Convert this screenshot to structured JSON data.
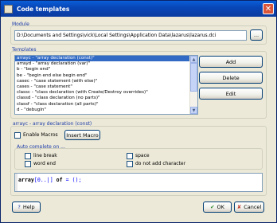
{
  "window": {
    "title": "Code templates",
    "close_glyph": "✕"
  },
  "module": {
    "group_label": "Module",
    "path": "D:\\Documents and Settings\\vick\\Local Settings\\Application Data\\lazarus\\lazarus.dci",
    "browse_label": "..."
  },
  "templates": {
    "group_label": "Templates",
    "items": [
      "arrayc - \"array declaration (const)\"",
      "arrayd - \"array declaration (var)\"",
      "b - \"begin end\"",
      "be - \"begin end else begin end\"",
      "casec - \"case statement (with else)\"",
      "cases - \"case statement\"",
      "classc - \"class declaration (with Create/Destroy overrides)\"",
      "classd - \"class declaration (no parts)\"",
      "classf - \"class declaration (all parts)\"",
      "d - \"debugln\""
    ],
    "selected_index": 0,
    "add_label": "Add",
    "delete_label": "Delete",
    "edit_label": "Edit"
  },
  "details": {
    "selected_caption": "arrayc - array declaration (const)",
    "enable_macros_label": "Enable Macros",
    "insert_macro_label": "Insert Macro",
    "auto_complete_label": "Auto complete on ...",
    "options": {
      "line_break": "line break",
      "word_end": "word end",
      "space": "space",
      "do_not_add_character": "do not add character"
    },
    "code": {
      "keyword1": "array",
      "part1": "[0..|]",
      "keyword2": "of",
      "part2": "= ();"
    }
  },
  "footer": {
    "help_label": "Help",
    "ok_label": "OK",
    "cancel_label": "Cancel"
  },
  "colors": {
    "accent": "#316ac5",
    "titlebar": "#0a46b8",
    "link_label": "#1b3aa8"
  }
}
